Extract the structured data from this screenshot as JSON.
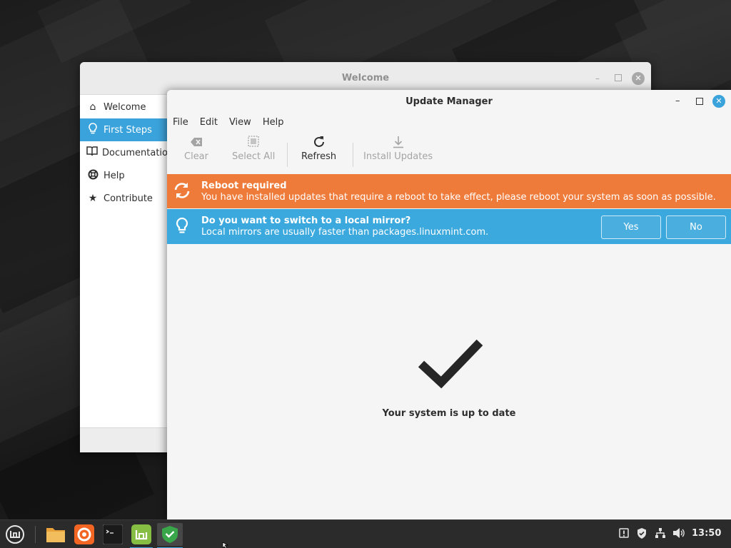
{
  "welcome_window": {
    "title": "Welcome",
    "sidebar": [
      {
        "label": "Welcome",
        "icon": "home-icon"
      },
      {
        "label": "First Steps",
        "icon": "lightbulb-icon",
        "active": true
      },
      {
        "label": "Documentation",
        "icon": "book-icon"
      },
      {
        "label": "Help",
        "icon": "lifebuoy-icon"
      },
      {
        "label": "Contribute",
        "icon": "star-icon"
      }
    ]
  },
  "update_manager": {
    "title": "Update Manager",
    "menu": [
      "File",
      "Edit",
      "View",
      "Help"
    ],
    "toolbar": {
      "clear": "Clear",
      "select_all": "Select All",
      "refresh": "Refresh",
      "install_updates": "Install Updates"
    },
    "reboot_banner": {
      "title": "Reboot required",
      "text": "You have installed updates that require a reboot to take effect, please reboot your system as soon as possible.",
      "color": "#ef7b3a"
    },
    "mirror_banner": {
      "title": "Do you want to switch to a local mirror?",
      "text": "Local mirrors are usually faster than packages.linuxmint.com.",
      "yes": "Yes",
      "no": "No",
      "color": "#3ba9dd"
    },
    "status": "Your system is up to date"
  },
  "taskbar": {
    "clock": "13:50",
    "apps": [
      "menu-icon",
      "files-icon",
      "firefox-icon",
      "terminal-icon",
      "mint-welcome-icon",
      "update-manager-icon"
    ]
  },
  "accent_color": "#3ba3db"
}
